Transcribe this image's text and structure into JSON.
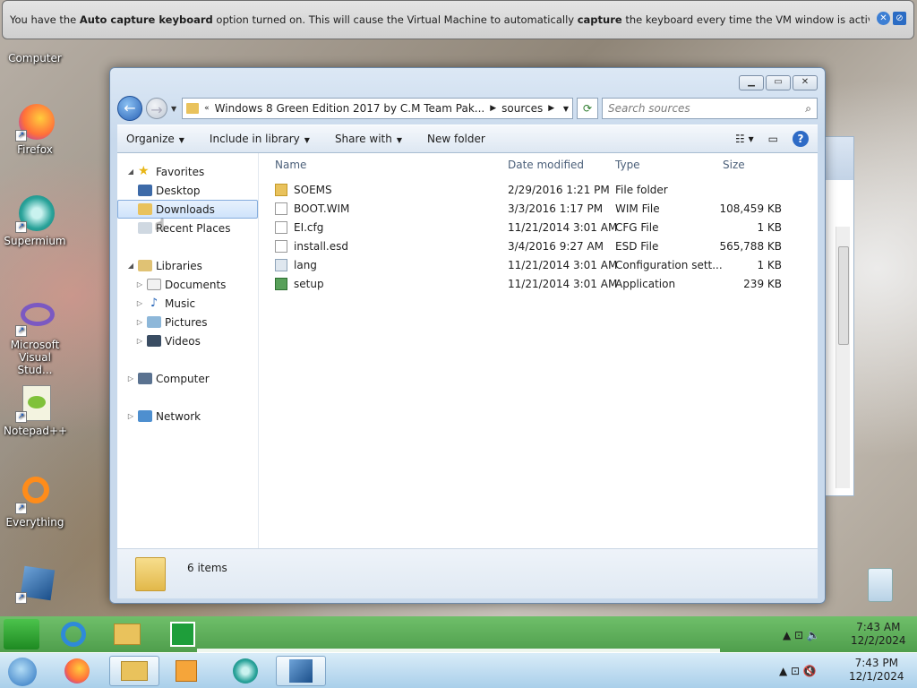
{
  "vm_bar": {
    "msg_prefix": "You have the ",
    "msg_bold1": "Auto capture keyboard",
    "msg_mid": " option turned on. This will cause the Virtual Machine to automatically ",
    "msg_bold2": "capture",
    "msg_suffix": " the keyboard every time the VM window is activated and make it unavailable to"
  },
  "desktop": {
    "icons": [
      "Computer",
      "Firefox",
      "Supermium",
      "Microsoft Visual Stud...",
      "Notepad++",
      "Everything"
    ]
  },
  "explorer": {
    "breadcrumb": [
      "Windows 8 Green Edition 2017 by C.M Team Pak...",
      "sources"
    ],
    "search_placeholder": "Search sources",
    "toolbar": [
      "Organize",
      "Include in library",
      "Share with",
      "New folder"
    ],
    "nav": {
      "favorites": "Favorites",
      "desktop": "Desktop",
      "downloads": "Downloads",
      "recent": "Recent Places",
      "libraries": "Libraries",
      "documents": "Documents",
      "music": "Music",
      "pictures": "Pictures",
      "videos": "Videos",
      "computer": "Computer",
      "network": "Network"
    },
    "columns": [
      "Name",
      "Date modified",
      "Type",
      "Size"
    ],
    "files": [
      {
        "name": "SOEMS",
        "date": "2/29/2016 1:21 PM",
        "type": "File folder",
        "size": ""
      },
      {
        "name": "BOOT.WIM",
        "date": "3/3/2016 1:17 PM",
        "type": "WIM File",
        "size": "108,459 KB"
      },
      {
        "name": "EI.cfg",
        "date": "11/21/2014 3:01 AM",
        "type": "CFG File",
        "size": "1 KB"
      },
      {
        "name": "install.esd",
        "date": "3/4/2016 9:27 AM",
        "type": "ESD File",
        "size": "565,788 KB"
      },
      {
        "name": "lang",
        "date": "11/21/2014 3:01 AM",
        "type": "Configuration sett...",
        "size": "1 KB"
      },
      {
        "name": "setup",
        "date": "11/21/2014 3:01 AM",
        "type": "Application",
        "size": "239 KB"
      }
    ],
    "item_count": "6 items"
  },
  "tray": {
    "guest_time": "7:43 AM",
    "guest_date": "12/2/2024",
    "host_time": "7:43 PM",
    "host_date": "12/1/2024"
  }
}
